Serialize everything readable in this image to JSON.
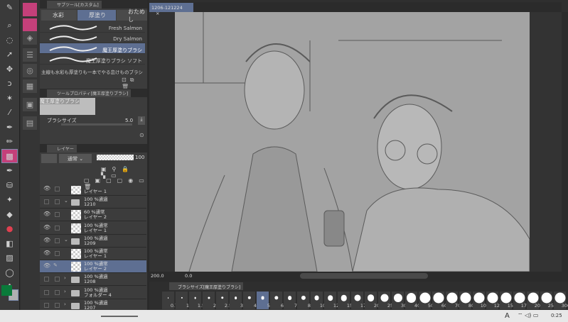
{
  "document_tab": {
    "title": "1206-121224",
    "close": "×"
  },
  "toolbar": {
    "tools": [
      "pen-header",
      "zoom",
      "select-lasso",
      "object",
      "move",
      "lasso",
      "magic-wand",
      "eyedropper",
      "pen",
      "pencil",
      "brush",
      "airbrush",
      "decoration",
      "sparkle",
      "eraser",
      "blend",
      "fill",
      "gradient",
      "figure",
      "text"
    ],
    "selected_index": 10,
    "main_color": "#0a7a3a",
    "sub_color": "#b0b0b0"
  },
  "subtool": {
    "header": "サブツール[カスタム]",
    "tabs": [
      {
        "label": "水彩"
      },
      {
        "label": "厚塗り"
      },
      {
        "label": "おためし"
      }
    ],
    "selected_tab": 1,
    "brushes": [
      {
        "label": "Fresh Salmon"
      },
      {
        "label": "Dry Salmon"
      },
      {
        "label": "魔王厚塗りブラシ"
      },
      {
        "label": "魔王厚塗りブラシ ソフト"
      },
      {
        "label": "主線も水彩も厚塗りも一本でやる怠けものブラシ"
      }
    ],
    "selected_brush": 2
  },
  "tool_property": {
    "header": "ツールプロパティ[魔王厚塗りブラシ]",
    "preview_label": "魔王厚塗りブラシ",
    "size_label": "ブラシサイズ",
    "size_value": "5.0"
  },
  "layer_panel": {
    "header": "レイヤー",
    "blend_mode": "通常",
    "opacity": "100",
    "layers": [
      {
        "line1": "",
        "line2": "レイヤー 1",
        "type": "layer",
        "eye": true
      },
      {
        "line1": "100 %通過",
        "line2": "1210",
        "type": "folder",
        "open": true,
        "eye": false
      },
      {
        "line1": "60 %通常",
        "line2": "レイヤー 2",
        "type": "layer",
        "eye": true
      },
      {
        "line1": "100 %通常",
        "line2": "レイヤー 1",
        "type": "layer",
        "eye": true
      },
      {
        "line1": "100 %通過",
        "line2": "1209",
        "type": "folder",
        "open": true,
        "eye": true
      },
      {
        "line1": "100 %通常",
        "line2": "レイヤー 1",
        "type": "layer",
        "eye": true
      },
      {
        "line1": "100 %通常",
        "line2": "レイヤー 2",
        "type": "layer",
        "eye": true,
        "selected": true
      },
      {
        "line1": "100 %通過",
        "line2": "1208",
        "type": "folder",
        "open": false,
        "eye": false
      },
      {
        "line1": "100 %通過",
        "line2": "フォルダー 4",
        "type": "folder",
        "open": false,
        "eye": false
      },
      {
        "line1": "100 %通過",
        "line2": "1207",
        "type": "folder",
        "open": false,
        "eye": false
      }
    ]
  },
  "canvas_status": {
    "zoom": "200.0",
    "angle": "0.0"
  },
  "brush_size_panel": {
    "header": "ブラシサイズ[魔王厚塗りブラシ]",
    "sizes": [
      "0.7",
      "1",
      "1.5",
      "2",
      "2.5",
      "3",
      "4",
      "5",
      "6",
      "7",
      "8",
      "10",
      "12",
      "15",
      "17",
      "20",
      "25",
      "30",
      "40",
      "50",
      "60",
      "70",
      "80",
      "100",
      "120",
      "150",
      "170",
      "200",
      "250",
      "300"
    ],
    "selected": "5"
  },
  "system_bar": {
    "ime": "A",
    "time": "0:25"
  }
}
